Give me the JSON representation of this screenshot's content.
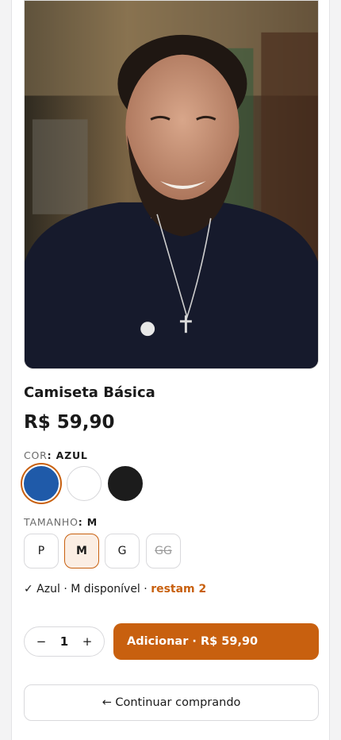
{
  "product": {
    "title": "Camiseta Básica",
    "price": "R$ 59,90"
  },
  "color_option": {
    "label": "COR",
    "selected": ": AZUL",
    "swatches": [
      {
        "name": "Azul",
        "hex": "#1f5aa9",
        "selected": true
      },
      {
        "name": "Branco",
        "hex": "#ffffff",
        "selected": false
      },
      {
        "name": "Preto",
        "hex": "#1c1c1c",
        "selected": false
      }
    ]
  },
  "size_option": {
    "label": "TAMANHO",
    "selected": ": M",
    "sizes": [
      {
        "label": "P",
        "state": "available"
      },
      {
        "label": "M",
        "state": "selected"
      },
      {
        "label": "G",
        "state": "available"
      },
      {
        "label": "GG",
        "state": "unavailable"
      }
    ]
  },
  "stock": {
    "text": "✓ Azul · M disponível ·",
    "low": "restam 2"
  },
  "quantity": {
    "minus": "−",
    "value": "1",
    "plus": "+"
  },
  "add_button": "Adicionar · R$ 59,90",
  "continue_button": "← Continuar comprando",
  "colors": {
    "accent": "#c8600f",
    "accent_soft": "#fbeee4"
  }
}
